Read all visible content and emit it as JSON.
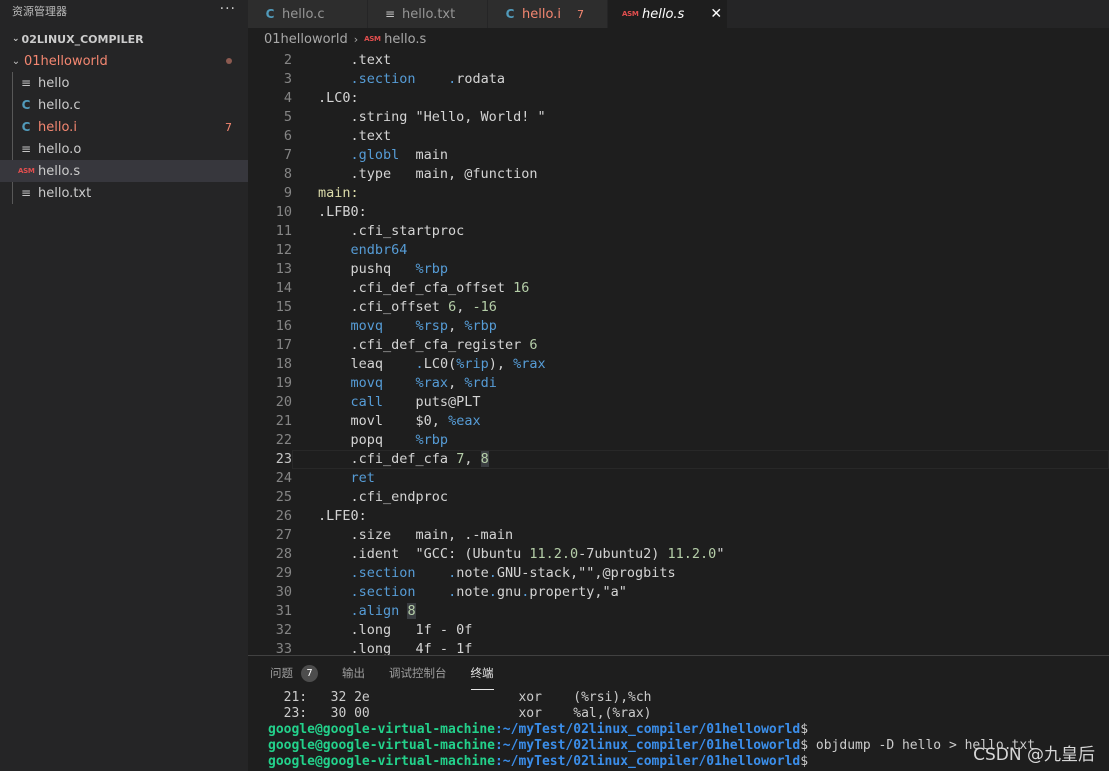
{
  "sidebar": {
    "title": "资源管理器",
    "more": "···",
    "project": "02LINUX_COMPILER",
    "folder": "01helloworld",
    "files": [
      {
        "name": "hello",
        "icon": "lines-icon",
        "state": "normal",
        "badge": ""
      },
      {
        "name": "hello.c",
        "icon": "c-icon",
        "state": "normal",
        "badge": ""
      },
      {
        "name": "hello.i",
        "icon": "c-icon",
        "state": "error",
        "badge": "7"
      },
      {
        "name": "hello.o",
        "icon": "lines-icon",
        "state": "normal",
        "badge": ""
      },
      {
        "name": "hello.s",
        "icon": "asm-icon",
        "state": "active",
        "badge": ""
      },
      {
        "name": "hello.txt",
        "icon": "lines-icon",
        "state": "normal",
        "badge": ""
      }
    ]
  },
  "tabs": [
    {
      "label": "hello.c",
      "icon": "c-icon",
      "state": "normal",
      "badge": ""
    },
    {
      "label": "hello.txt",
      "icon": "lines-icon",
      "state": "normal",
      "badge": ""
    },
    {
      "label": "hello.i",
      "icon": "c-icon",
      "state": "error",
      "badge": "7"
    },
    {
      "label": "hello.s",
      "icon": "asm-icon",
      "state": "active",
      "badge": ""
    }
  ],
  "breadcrumb": {
    "folder": "01helloworld",
    "file": "hello.s",
    "file_icon": "asm-icon"
  },
  "icon_glyphs": {
    "c": "C",
    "asm": "ASM",
    "lines": "≡",
    "close": "✕",
    "chevron": "⌄",
    "crumb": "›"
  },
  "editor": {
    "current_line": 23,
    "lines": [
      {
        "n": 2,
        "tokens": [
          [
            "    ",
            ""
          ],
          [
            ".text",
            ""
          ]
        ]
      },
      {
        "n": 3,
        "tokens": [
          [
            "    ",
            ""
          ],
          [
            ".section",
            "blue"
          ],
          [
            "    ",
            ""
          ],
          [
            ".",
            "blue"
          ],
          [
            "rodata",
            ""
          ]
        ]
      },
      {
        "n": 4,
        "tokens": [
          [
            ".LC0:",
            ""
          ]
        ]
      },
      {
        "n": 5,
        "tokens": [
          [
            "    ",
            ""
          ],
          [
            ".string \"Hello, World! \"",
            ""
          ]
        ]
      },
      {
        "n": 6,
        "tokens": [
          [
            "    ",
            ""
          ],
          [
            ".text",
            ""
          ]
        ]
      },
      {
        "n": 7,
        "tokens": [
          [
            "    ",
            ""
          ],
          [
            ".globl",
            "blue"
          ],
          [
            "  main",
            ""
          ]
        ]
      },
      {
        "n": 8,
        "tokens": [
          [
            "    ",
            ""
          ],
          [
            ".type",
            ""
          ],
          [
            "   main, @function",
            ""
          ]
        ]
      },
      {
        "n": 9,
        "tokens": [
          [
            "main:",
            "label"
          ]
        ]
      },
      {
        "n": 10,
        "tokens": [
          [
            ".LFB0:",
            ""
          ]
        ]
      },
      {
        "n": 11,
        "tokens": [
          [
            "    ",
            ""
          ],
          [
            ".cfi_startproc",
            ""
          ]
        ]
      },
      {
        "n": 12,
        "tokens": [
          [
            "    ",
            ""
          ],
          [
            "endbr64",
            "blue"
          ]
        ]
      },
      {
        "n": 13,
        "tokens": [
          [
            "    ",
            ""
          ],
          [
            "pushq",
            ""
          ],
          [
            "   ",
            ""
          ],
          [
            "%rbp",
            "blue"
          ]
        ]
      },
      {
        "n": 14,
        "tokens": [
          [
            "    ",
            ""
          ],
          [
            ".cfi_def_cfa_offset ",
            ""
          ],
          [
            "16",
            "num"
          ]
        ]
      },
      {
        "n": 15,
        "tokens": [
          [
            "    ",
            ""
          ],
          [
            ".cfi_offset ",
            ""
          ],
          [
            "6",
            "num"
          ],
          [
            ", ",
            ""
          ],
          [
            "-16",
            "num"
          ]
        ]
      },
      {
        "n": 16,
        "tokens": [
          [
            "    ",
            ""
          ],
          [
            "movq",
            "blue"
          ],
          [
            "    ",
            ""
          ],
          [
            "%rsp",
            "blue"
          ],
          [
            ", ",
            ""
          ],
          [
            "%rbp",
            "blue"
          ]
        ]
      },
      {
        "n": 17,
        "tokens": [
          [
            "    ",
            ""
          ],
          [
            ".cfi_def_cfa_register ",
            ""
          ],
          [
            "6",
            "num"
          ]
        ]
      },
      {
        "n": 18,
        "tokens": [
          [
            "    ",
            ""
          ],
          [
            "leaq",
            ""
          ],
          [
            "    ",
            ""
          ],
          [
            ".",
            "blue"
          ],
          [
            "LC0(",
            ""
          ],
          [
            "%rip",
            "blue"
          ],
          [
            "), ",
            ""
          ],
          [
            "%rax",
            "blue"
          ]
        ]
      },
      {
        "n": 19,
        "tokens": [
          [
            "    ",
            ""
          ],
          [
            "movq",
            "blue"
          ],
          [
            "    ",
            ""
          ],
          [
            "%rax",
            "blue"
          ],
          [
            ", ",
            ""
          ],
          [
            "%rdi",
            "blue"
          ]
        ]
      },
      {
        "n": 20,
        "tokens": [
          [
            "    ",
            ""
          ],
          [
            "call",
            "blue"
          ],
          [
            "    puts@PLT",
            ""
          ]
        ]
      },
      {
        "n": 21,
        "tokens": [
          [
            "    ",
            ""
          ],
          [
            "movl",
            ""
          ],
          [
            "    $0, ",
            ""
          ],
          [
            "%eax",
            "blue"
          ]
        ]
      },
      {
        "n": 22,
        "tokens": [
          [
            "    ",
            ""
          ],
          [
            "popq",
            ""
          ],
          [
            "    ",
            ""
          ],
          [
            "%rbp",
            "blue"
          ]
        ]
      },
      {
        "n": 23,
        "tokens": [
          [
            "    ",
            ""
          ],
          [
            ".cfi_def_cfa ",
            ""
          ],
          [
            "7",
            "num"
          ],
          [
            ", ",
            ""
          ],
          [
            "8",
            "numhl"
          ]
        ]
      },
      {
        "n": 24,
        "tokens": [
          [
            "    ",
            ""
          ],
          [
            "ret",
            "blue"
          ]
        ]
      },
      {
        "n": 25,
        "tokens": [
          [
            "    ",
            ""
          ],
          [
            ".cfi_endproc",
            ""
          ]
        ]
      },
      {
        "n": 26,
        "tokens": [
          [
            ".LFE0:",
            ""
          ]
        ]
      },
      {
        "n": 27,
        "tokens": [
          [
            "    ",
            ""
          ],
          [
            ".size",
            ""
          ],
          [
            "   main, .-main",
            ""
          ]
        ]
      },
      {
        "n": 28,
        "tokens": [
          [
            "    ",
            ""
          ],
          [
            ".ident",
            ""
          ],
          [
            "  \"GCC: (Ubuntu ",
            ""
          ],
          [
            "11.2.0",
            "num"
          ],
          [
            "-7ubuntu2) ",
            ""
          ],
          [
            "11.2.0",
            "num"
          ],
          [
            "\"",
            ""
          ]
        ]
      },
      {
        "n": 29,
        "tokens": [
          [
            "    ",
            ""
          ],
          [
            ".section",
            "blue"
          ],
          [
            "    ",
            ""
          ],
          [
            ".",
            "blue"
          ],
          [
            "note",
            ""
          ],
          [
            ".",
            "blue"
          ],
          [
            "GNU-stack,\"\",@progbits",
            ""
          ]
        ]
      },
      {
        "n": 30,
        "tokens": [
          [
            "    ",
            ""
          ],
          [
            ".section",
            "blue"
          ],
          [
            "    ",
            ""
          ],
          [
            ".",
            "blue"
          ],
          [
            "note",
            ""
          ],
          [
            ".",
            "blue"
          ],
          [
            "gnu",
            ""
          ],
          [
            ".",
            "blue"
          ],
          [
            "property,\"a\"",
            ""
          ]
        ]
      },
      {
        "n": 31,
        "tokens": [
          [
            "    ",
            ""
          ],
          [
            ".align",
            "blue"
          ],
          [
            " ",
            ""
          ],
          [
            "8",
            "numhl"
          ]
        ]
      },
      {
        "n": 32,
        "tokens": [
          [
            "    ",
            ""
          ],
          [
            ".long",
            ""
          ],
          [
            "   1f - 0f",
            ""
          ]
        ]
      },
      {
        "n": 33,
        "tokens": [
          [
            "    ",
            ""
          ],
          [
            ".long",
            ""
          ],
          [
            "   4f - 1f",
            ""
          ]
        ]
      }
    ]
  },
  "panel": {
    "tabs": [
      {
        "label": "问题",
        "badge": "7",
        "active": false
      },
      {
        "label": "输出",
        "badge": "",
        "active": false
      },
      {
        "label": "调试控制台",
        "badge": "",
        "active": false
      },
      {
        "label": "终端",
        "badge": "",
        "active": true
      }
    ],
    "terminal": [
      {
        "user": "",
        "path": "",
        "text": "  21:   32 2e                 \txor    (%rsi),%ch"
      },
      {
        "user": "",
        "path": "",
        "text": "  23:   30 00                 \txor    %al,(%rax)"
      },
      {
        "user": "google@google-virtual-machine",
        "path": ":~/myTest/02linux_compiler/01helloworld",
        "text": "$"
      },
      {
        "user": "google@google-virtual-machine",
        "path": ":~/myTest/02linux_compiler/01helloworld",
        "text": "$ objdump -D hello > hello.txt"
      },
      {
        "user": "google@google-virtual-machine",
        "path": ":~/myTest/02linux_compiler/01helloworld",
        "text": "$"
      }
    ]
  },
  "watermark": "CSDN @九皇后"
}
